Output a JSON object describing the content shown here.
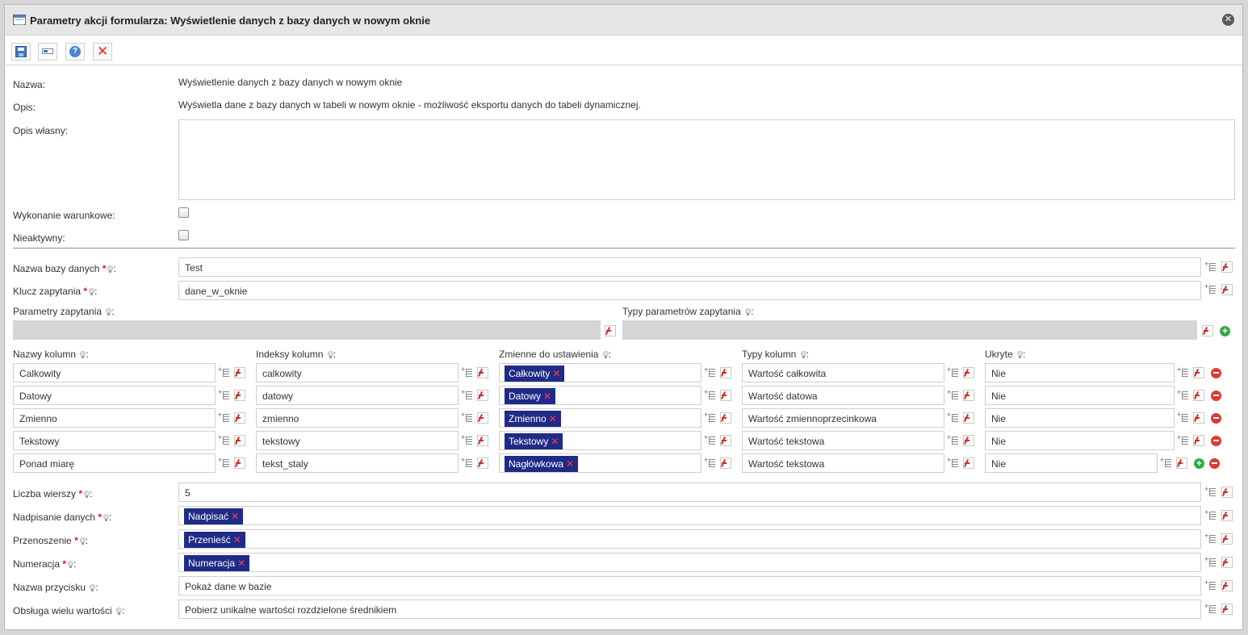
{
  "dialog": {
    "title": "Parametry akcji formularza: Wyświetlenie danych z bazy danych w nowym oknie",
    "close_icon": "close-icon"
  },
  "toolbar": {
    "buttons": [
      "save-icon",
      "field-icon",
      "help-icon",
      "delete-icon"
    ]
  },
  "info": {
    "name_label": "Nazwa:",
    "name_value": "Wyświetlenie danych z bazy danych w nowym oknie",
    "desc_label": "Opis:",
    "desc_value": "Wyświetla dane z bazy danych w tabeli w nowym oknie - możliwość eksportu danych do tabeli dynamicznej.",
    "own_desc_label": "Opis własny:",
    "own_desc_value": "",
    "conditional_label": "Wykonanie warunkowe:",
    "conditional_checked": false,
    "inactive_label": "Nieaktywny:",
    "inactive_checked": false
  },
  "db": {
    "dbname_label": "Nazwa bazy danych",
    "dbname_value": "Test",
    "key_label": "Klucz zapytania",
    "key_value": "dane_w_oknie",
    "params_label": "Parametry zapytania",
    "param_types_label": "Typy parametrów zapytania"
  },
  "columns": {
    "headers": {
      "names": "Nazwy kolumn",
      "indexes": "Indeksy kolumn",
      "vars": "Zmienne do ustawienia",
      "types": "Typy kolumn",
      "hidden": "Ukryte"
    },
    "rows": [
      {
        "name": "Calkowity",
        "index": "calkowity",
        "var": "Całkowity",
        "type": "Wartość całkowita",
        "hidden": "Nie"
      },
      {
        "name": "Datowy",
        "index": "datowy",
        "var": "Datowy",
        "type": "Wartość datowa",
        "hidden": "Nie"
      },
      {
        "name": "Zmienno",
        "index": "zmienno",
        "var": "Zmienno",
        "type": "Wartość zmiennoprzecinkowa",
        "hidden": "Nie"
      },
      {
        "name": "Tekstowy",
        "index": "tekstowy",
        "var": "Tekstowy",
        "type": "Wartość tekstowa",
        "hidden": "Nie"
      },
      {
        "name": "Ponad miarę",
        "index": "tekst_staly",
        "var": "Nagłówkowa",
        "type": "Wartość tekstowa",
        "hidden": "Nie"
      }
    ]
  },
  "options": {
    "rows_label": "Liczba wierszy",
    "rows_value": "5",
    "overwrite_label": "Nadpisanie danych",
    "overwrite_value": "Nadpisać",
    "transfer_label": "Przenoszenie",
    "transfer_value": "Przenieść",
    "numbering_label": "Numeracja",
    "numbering_value": "Numeracja",
    "button_label": "Nazwa przycisku",
    "button_value": "Pokaż dane w bazie",
    "multi_label": "Obsługa wielu wartości",
    "multi_value": "Pobierz unikalne wartości rozdzielone średnikiem"
  }
}
